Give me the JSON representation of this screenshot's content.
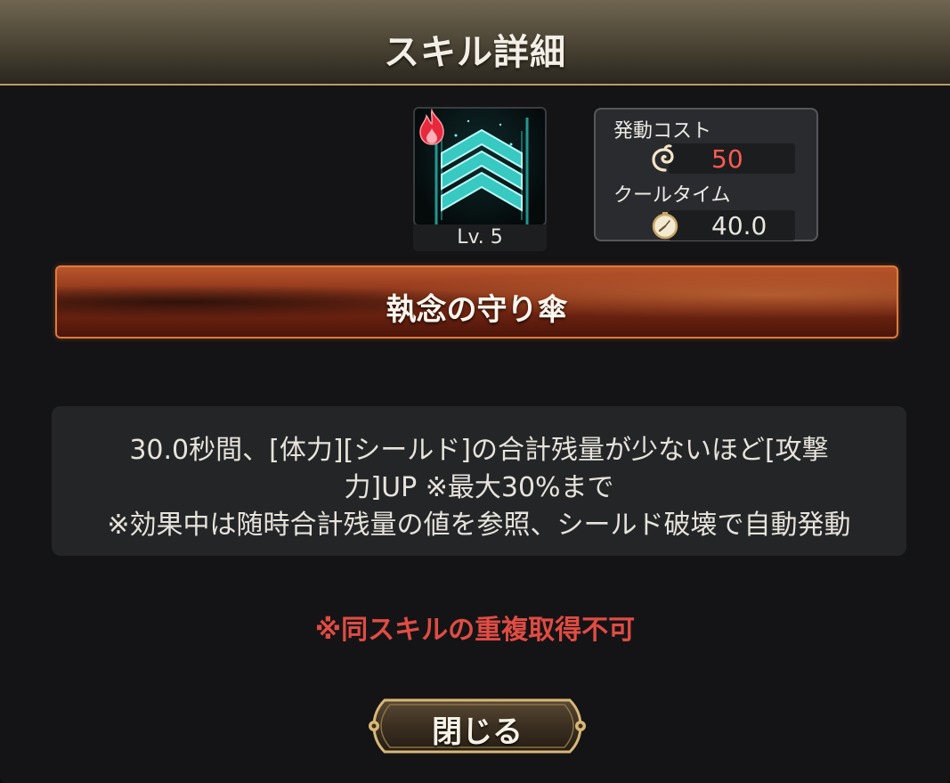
{
  "dialog": {
    "title": "スキル詳細"
  },
  "skill": {
    "icon": "teal-chevron-rank-icon",
    "element_icon": "fire-element-icon",
    "level_label": "Lv. 5",
    "name": "執念の守り傘"
  },
  "cost_panel": {
    "activation_cost_label": "発動コスト",
    "activation_cost_icon": "spiral-cost-icon",
    "activation_cost_value": "50",
    "cooldown_label": "クールタイム",
    "cooldown_icon": "stopwatch-icon",
    "cooldown_value": "40.0"
  },
  "description": {
    "lines": [
      "30.0秒間、[体力][シールド]の合計残量が少ないほど[攻撃",
      "力]UP ※最大30%まで",
      "※効果中は随時合計残量の値を参照、シールド破壊で自動発動"
    ]
  },
  "warning": "※同スキルの重複取得不可",
  "buttons": {
    "close_label": "閉じる"
  },
  "colors": {
    "header": "#5e5544",
    "header_border": "#b79b63",
    "banner": "#8a3218",
    "cost_value": "#ff5a52",
    "warning": "#e04c43",
    "icon_accent": "#3fd6cf"
  }
}
